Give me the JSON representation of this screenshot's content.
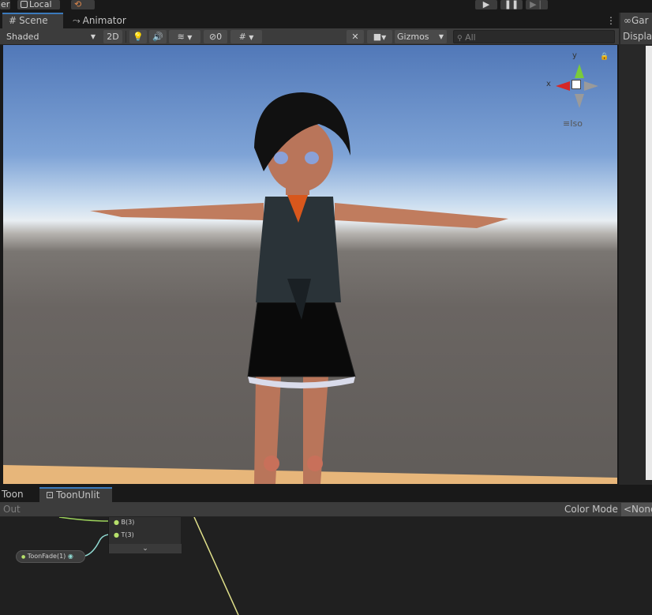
{
  "top": {
    "left_label": "er",
    "local_label": "Local",
    "play_icon": "play-icon",
    "pause_icon": "pause-icon",
    "step_icon": "step-icon"
  },
  "tabs": [
    {
      "label": "Scene",
      "icon": "hash-icon"
    },
    {
      "label": "Animator",
      "icon": "animator-icon"
    }
  ],
  "right_tab": {
    "label": "Gar",
    "sublabel": "Display"
  },
  "toolbar": {
    "shading": "Shaded",
    "mode_2d": "2D",
    "hidden_count": "0",
    "gizmos": "Gizmos",
    "search_placeholder": "All"
  },
  "gizmo": {
    "x": "x",
    "y": "y",
    "projection": "Iso"
  },
  "bottom": {
    "tabs": [
      "Toon",
      "ToonUnlit"
    ],
    "out_label": "Out",
    "color_mode_label": "Color Mode",
    "color_mode_value": "<None",
    "node_port_b": "B(3)",
    "node_port_t": "T(3)",
    "node_fade": "ToonFade(1)"
  },
  "colors": {
    "accent": "#3a79bb",
    "panel": "#3c3c3c",
    "dark": "#191919"
  }
}
